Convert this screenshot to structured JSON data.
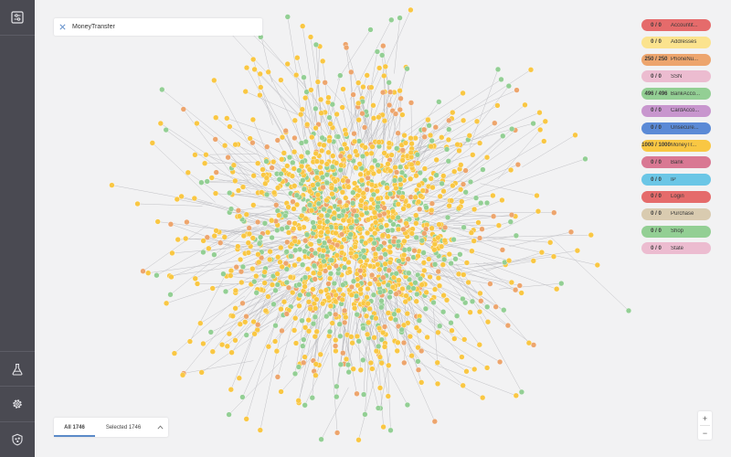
{
  "search": {
    "value": "MoneyTransfer",
    "clear_icon": "close-icon"
  },
  "sidebar": {
    "top_icon": "sliders-panel-icon",
    "bottom_icons": [
      "flask-icon",
      "gear-icon",
      "logo-icon"
    ]
  },
  "legend": [
    {
      "count": "0 / 0",
      "label": "Accountit...",
      "color": "#e56b6b"
    },
    {
      "count": "0 / 0",
      "label": "Addresses",
      "color": "#fbe38e"
    },
    {
      "count": "250 / 250",
      "label": "PhoneNu...",
      "color": "#eda56d"
    },
    {
      "count": "0 / 0",
      "label": "SSN",
      "color": "#ecbcd0"
    },
    {
      "count": "496 / 496",
      "label": "BankAcco...",
      "color": "#93cf94"
    },
    {
      "count": "0 / 0",
      "label": "CardAcco...",
      "color": "#c896ce"
    },
    {
      "count": "0 / 0",
      "label": "Unsecure...",
      "color": "#5b8ad6"
    },
    {
      "count": "1000 / 1000",
      "label": "MoneyTr...",
      "color": "#f9c743"
    },
    {
      "count": "0 / 0",
      "label": "Bank",
      "color": "#d97893"
    },
    {
      "count": "0 / 0",
      "label": "IP",
      "color": "#6bc6e6"
    },
    {
      "count": "0 / 0",
      "label": "Login",
      "color": "#e56b6b"
    },
    {
      "count": "0 / 0",
      "label": "Purchase",
      "color": "#d9cbb0"
    },
    {
      "count": "0 / 0",
      "label": "Shop",
      "color": "#93cf94"
    },
    {
      "count": "0 / 0",
      "label": "State",
      "color": "#ecbcd0"
    }
  ],
  "graph": {
    "node_counts": {
      "MoneyTransfer": 1000,
      "BankAccount": 496,
      "PhoneNumber": 250
    },
    "colors": {
      "MoneyTransfer": "#f9c743",
      "BankAccount": "#93cf94",
      "PhoneNumber": "#eda56d",
      "edge": "#b9b9bd"
    }
  },
  "bottom_bar": {
    "all_label": "All 1746",
    "selected_label": "Selected 1746",
    "chevron_icon": "chevron-up-icon"
  },
  "zoom": {
    "in_label": "+",
    "out_label": "−"
  }
}
